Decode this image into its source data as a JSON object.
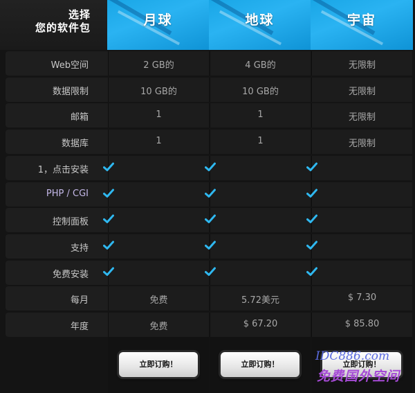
{
  "header": {
    "line1": "选择",
    "line2": "您的软件包",
    "plans": [
      "月球",
      "地球",
      "宇宙"
    ]
  },
  "rows": [
    {
      "label": "Web空间",
      "values": [
        "2 GB的",
        "4 GB的",
        "无限制"
      ]
    },
    {
      "label": "数据限制",
      "values": [
        "10 GB的",
        "10 GB的",
        "无限制"
      ]
    },
    {
      "label": "邮箱",
      "values": [
        "1",
        "1",
        "无限制"
      ]
    },
    {
      "label": "数据库",
      "values": [
        "1",
        "1",
        "无限制"
      ]
    },
    {
      "label": "1，点击安装",
      "check": true
    },
    {
      "label": "PHP / CGI",
      "check": true
    },
    {
      "label": "控制面板",
      "check": true
    },
    {
      "label": "支持",
      "check": true
    },
    {
      "label": "免费安装",
      "check": true
    },
    {
      "label": "每月",
      "values": [
        "免费",
        "5.72美元",
        "$ 7.30"
      ]
    },
    {
      "label": "年度",
      "values": [
        "免费",
        "$ 67.20",
        "$ 85.80"
      ]
    }
  ],
  "footer": {
    "buttons": [
      "立即订购！",
      "立即订购！",
      "立即订购！"
    ]
  },
  "watermark": {
    "line1": "IDC886.com",
    "line2": "免费国外空间"
  },
  "colors": {
    "accent": "#1fa9ea",
    "check": "#2fb8f0"
  }
}
